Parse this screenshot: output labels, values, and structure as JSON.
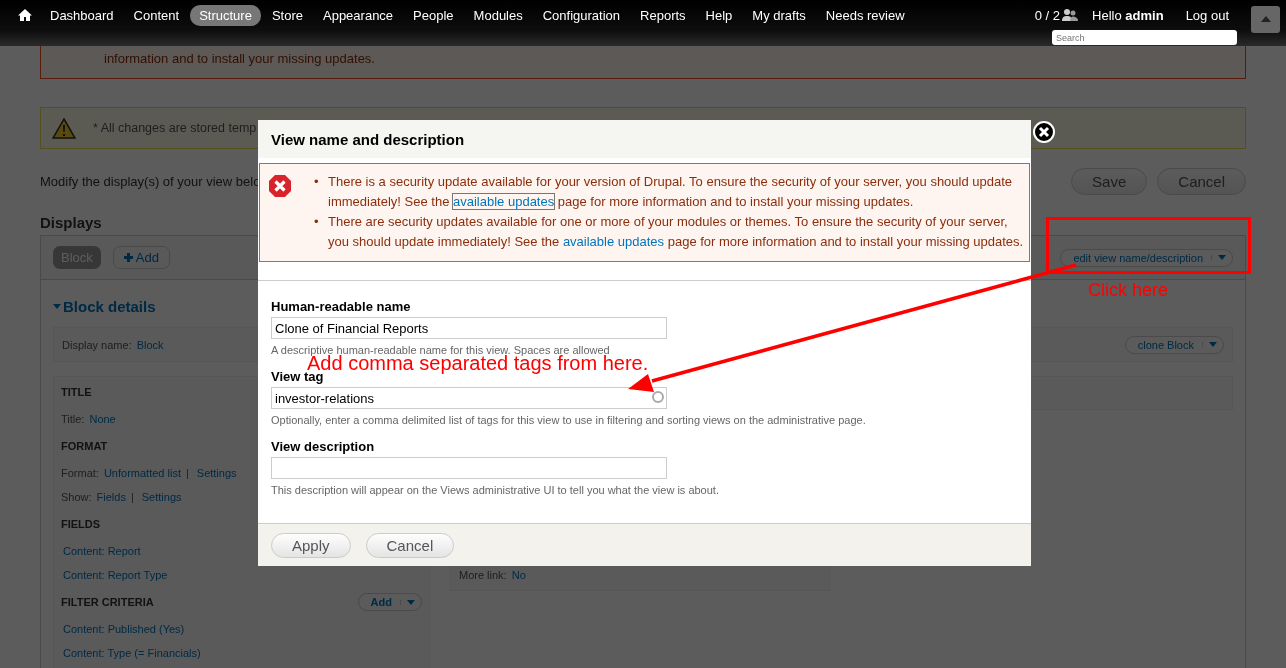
{
  "toolbar": {
    "items": [
      {
        "label": "Dashboard",
        "selected": false
      },
      {
        "label": "Content",
        "selected": false
      },
      {
        "label": "Structure",
        "selected": true
      },
      {
        "label": "Store",
        "selected": false
      },
      {
        "label": "Appearance",
        "selected": false
      },
      {
        "label": "People",
        "selected": false
      },
      {
        "label": "Modules",
        "selected": false
      },
      {
        "label": "Configuration",
        "selected": false
      },
      {
        "label": "Reports",
        "selected": false
      },
      {
        "label": "Help",
        "selected": false
      },
      {
        "label": "My drafts",
        "selected": false
      },
      {
        "label": "Needs review",
        "selected": false
      }
    ],
    "counter": "0 / 2",
    "greeting": "Hello **admin**",
    "logout": "Log out",
    "search": {
      "placeholder": "Search"
    }
  },
  "page": {
    "message_tail": "information and to install your missing updates.",
    "warning": "* All changes are stored temp",
    "intro": "Modify the display(s) of your view belo",
    "buttons": [
      "Save",
      "Cancel"
    ],
    "displays_heading": "Displays",
    "display_tabs": [
      {
        "label": "Block",
        "selected": true
      }
    ],
    "add_display": "Add",
    "edit_button": "edit view name/description",
    "details_title": "Block details",
    "display_name_label": "Display name:",
    "display_name": "Block",
    "clone_button": "clone Block",
    "sections": [
      {
        "title": "TITLE",
        "lines": [
          {
            "label": "Title:",
            "links": [
              "None"
            ]
          }
        ]
      },
      {
        "title": "FORMAT",
        "lines": [
          {
            "label": "Format:",
            "links": [
              "Unformatted list",
              "Settings"
            ],
            "separator": "|"
          },
          {
            "label": "Show:",
            "links": [
              "Fields",
              "Settings"
            ],
            "separator": "|"
          }
        ]
      },
      {
        "title": "FIELDS",
        "items": [
          "Content: Report",
          "Content: Report Type"
        ]
      },
      {
        "title": "FILTER CRITERIA",
        "add": "Add",
        "items": [
          "Content: Published (Yes)",
          "Content: Type (= Financials)"
        ]
      }
    ],
    "more_link": {
      "label": "More link:",
      "value": "No"
    }
  },
  "dialog": {
    "title": "View name and description",
    "messages": [
      {
        "bullet": "•",
        "before": "There is a security update available for your version of Drupal. To ensure the security of your server, you should update immediately! See the ",
        "link": "available updates",
        "after": " page for more information and to install your missing updates.",
        "focused": true
      },
      {
        "bullet": "•",
        "before": "There are security updates available for one or more of your modules or themes. To ensure the security of your server, you should update immediately! See the ",
        "link": "available updates",
        "after": " page for more information and to install your missing updates.",
        "focused": false
      }
    ],
    "fields": [
      {
        "label": "Human-readable name",
        "value": "Clone of Financial Reports",
        "help": "A descriptive human-readable name for this view. Spaces are allowed",
        "kind": "text"
      },
      {
        "label": "View tag",
        "value": "investor-relations",
        "help": "Optionally, enter a comma delimited list of tags for this view to use in filtering and sorting views on the administrative page.",
        "kind": "autocomplete"
      },
      {
        "label": "View description",
        "help": "This description will appear on the Views administrative UI to tell you what the view is about.",
        "kind": "text"
      }
    ],
    "buttons": [
      "Apply",
      "Cancel"
    ]
  },
  "annotations": {
    "click_note": "Click here",
    "tag_note": "Add comma separated tags from here."
  }
}
